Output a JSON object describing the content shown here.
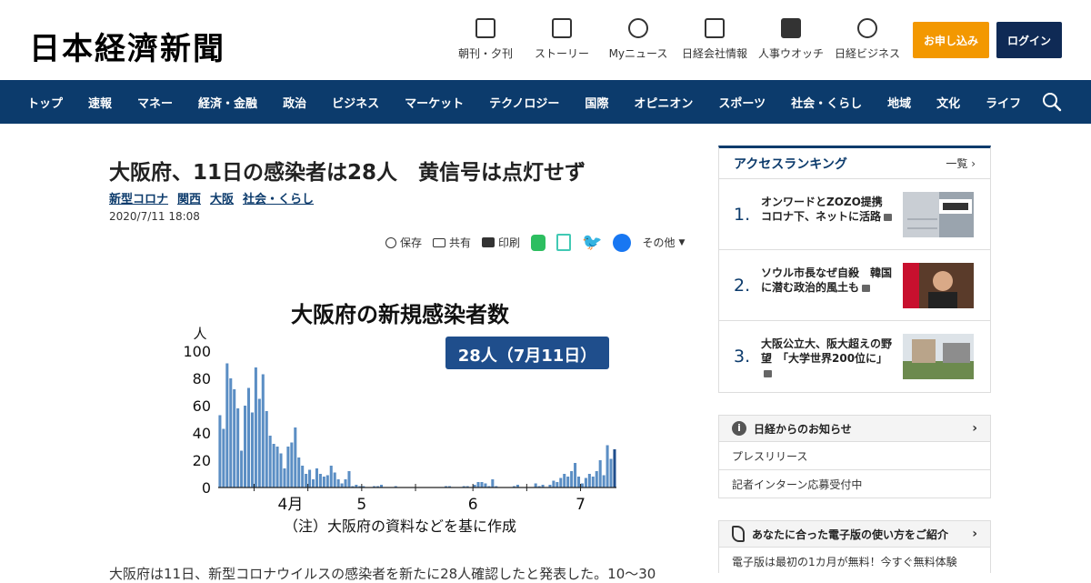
{
  "header": {
    "logo": "日本経濟新聞",
    "links": [
      {
        "label": "朝刊・夕刊",
        "icon": "newspaper-icon"
      },
      {
        "label": "ストーリー",
        "icon": "book-icon"
      },
      {
        "label": "Myニュース",
        "icon": "user-icon"
      },
      {
        "label": "日経会社情報",
        "icon": "chart-icon"
      },
      {
        "label": "人事ウオッチ",
        "icon": "search-person-icon"
      },
      {
        "label": "日経ビジネス",
        "icon": "compass-icon"
      }
    ],
    "apply_label": "お申し込み",
    "login_label": "ログイン",
    "apply_color": "#f39800",
    "login_color": "#0f2a55"
  },
  "nav": {
    "items": [
      "トップ",
      "速報",
      "マネー",
      "経済・金融",
      "政治",
      "ビジネス",
      "マーケット",
      "テクノロジー",
      "国際",
      "オピニオン",
      "スポーツ",
      "社会・くらし",
      "地域",
      "文化",
      "ライフ"
    ],
    "color": "#0c3b6c"
  },
  "article": {
    "title": "大阪府、11日の感染者は28人　黄信号は点灯せず",
    "tags": [
      "新型コロナ",
      "関西",
      "大阪",
      "社会・くらし"
    ],
    "date": "2020/7/11 18:08",
    "share": {
      "save": "保存",
      "share": "共有",
      "print": "印刷",
      "other": "その他"
    },
    "body_snippet": "大阪府は11日、新型コロナウイルスの感染者を新たに28人確認したと発表した。10〜30"
  },
  "chart_data": {
    "type": "bar",
    "title": "大阪府の新規感染者数",
    "badge": "28人（7月11日）",
    "ylabel": "人",
    "ylim": [
      0,
      100
    ],
    "yticks": [
      0,
      20,
      40,
      60,
      80,
      100
    ],
    "xticks": [
      "4月",
      "5",
      "6",
      "7"
    ],
    "note": "（注）大阪府の資料などを基に作成",
    "color": "#5b8ec4",
    "highlight_color": "#1f4e8c",
    "values": [
      53,
      43,
      91,
      80,
      72,
      58,
      27,
      60,
      73,
      55,
      88,
      65,
      83,
      56,
      38,
      32,
      30,
      25,
      14,
      30,
      33,
      44,
      22,
      16,
      10,
      13,
      6,
      14,
      10,
      8,
      9,
      16,
      11,
      6,
      3,
      6,
      12,
      1,
      2,
      1,
      1,
      0,
      0,
      1,
      1,
      2,
      0,
      0,
      0,
      1,
      0,
      0,
      0,
      0,
      0,
      0,
      0,
      0,
      0,
      0,
      0,
      0,
      0,
      1,
      1,
      0,
      0,
      0,
      1,
      1,
      0,
      2,
      4,
      4,
      3,
      1,
      6,
      1,
      0,
      0,
      0,
      0,
      1,
      2,
      0,
      0,
      0,
      0,
      3,
      1,
      2,
      0,
      2,
      5,
      4,
      7,
      10,
      8,
      12,
      18,
      8,
      3,
      7,
      10,
      8,
      12,
      20,
      9,
      31,
      21,
      28
    ]
  },
  "sidebar": {
    "ranking_title": "アクセスランキング",
    "ranking_more": "一覧",
    "ranking": [
      {
        "num": "1.",
        "text": "オンワードとZOZO提携　コロナ下、ネットに活路"
      },
      {
        "num": "2.",
        "text": "ソウル市長なぜ自殺　韓国に潜む政治的風土も"
      },
      {
        "num": "3.",
        "text": "大阪公立大、阪大超えの野望　「大学世界200位に」"
      }
    ],
    "notice_title": "日経からのお知らせ",
    "notice_rows": [
      "プレスリリース",
      "記者インターン応募受付中"
    ],
    "guide_title": "あなたに合った電子版の使い方をご紹介",
    "guide_text": "電子版は最初の1カ月が無料！今すぐ無料体験"
  }
}
